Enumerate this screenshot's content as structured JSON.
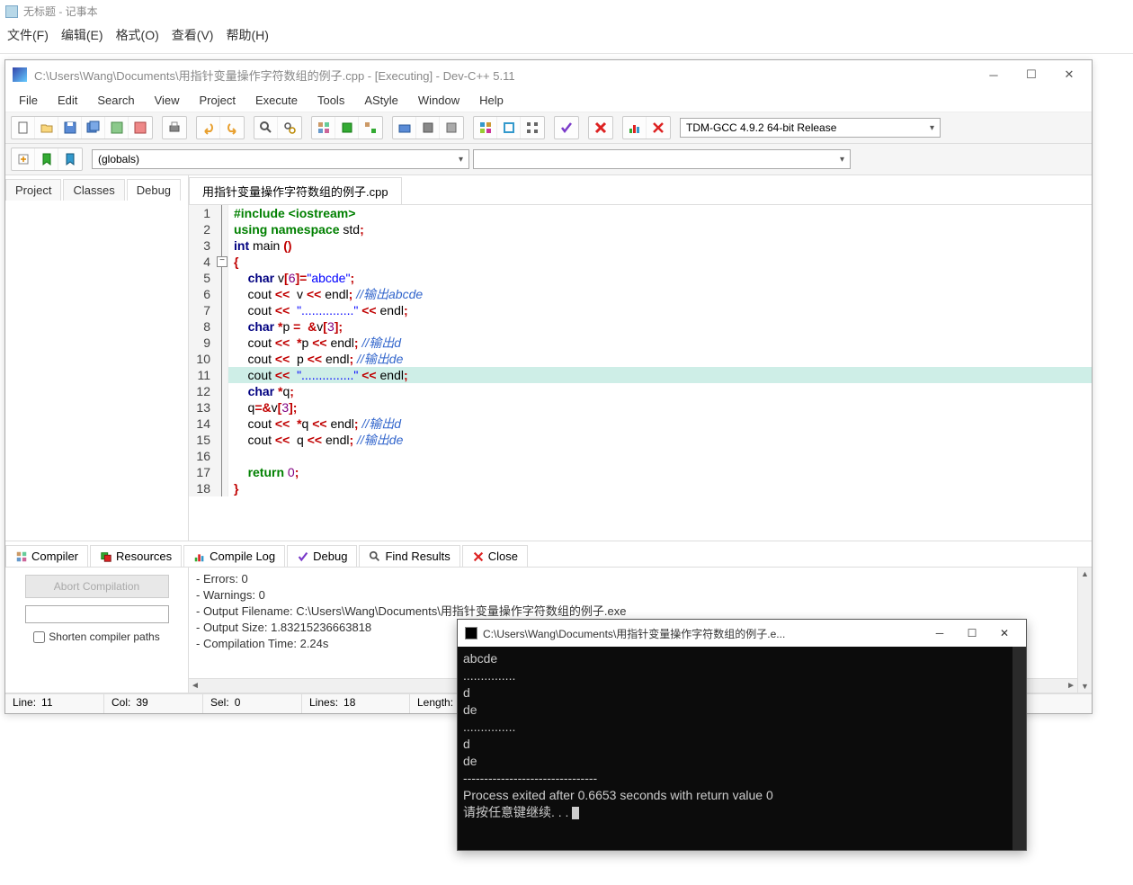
{
  "notepad": {
    "title": "无标题 - 记事本",
    "menu": [
      "文件(F)",
      "编辑(E)",
      "格式(O)",
      "查看(V)",
      "帮助(H)"
    ]
  },
  "devcpp": {
    "title": "C:\\Users\\Wang\\Documents\\用指针变量操作字符数组的例子.cpp - [Executing] - Dev-C++ 5.11",
    "menu": [
      "File",
      "Edit",
      "Search",
      "View",
      "Project",
      "Execute",
      "Tools",
      "AStyle",
      "Window",
      "Help"
    ],
    "compiler": "TDM-GCC 4.9.2 64-bit Release",
    "globals": "(globals)",
    "side_tabs": [
      "Project",
      "Classes",
      "Debug"
    ],
    "active_side_tab": "Debug",
    "file_tab": "用指针变量操作字符数组的例子.cpp",
    "bottom_tabs": [
      "Compiler",
      "Resources",
      "Compile Log",
      "Debug",
      "Find Results",
      "Close"
    ],
    "active_bottom_tab": "Compile Log",
    "abort_label": "Abort Compilation",
    "shorten_label": "Shorten compiler paths"
  },
  "code": {
    "lines": [
      {
        "n": 1,
        "tokens": [
          [
            "pp",
            "#include <iostream>"
          ]
        ]
      },
      {
        "n": 2,
        "tokens": [
          [
            "kw",
            "using namespace "
          ],
          [
            "txt",
            "std"
          ],
          [
            "op",
            ";"
          ]
        ]
      },
      {
        "n": 3,
        "tokens": [
          [
            "kw2",
            "int "
          ],
          [
            "txt",
            "main "
          ],
          [
            "op",
            "()"
          ]
        ]
      },
      {
        "n": 4,
        "fold": true,
        "tokens": [
          [
            "op",
            "{"
          ]
        ]
      },
      {
        "n": 5,
        "tokens": [
          [
            "txt",
            "    "
          ],
          [
            "kw2",
            "char "
          ],
          [
            "txt",
            "v"
          ],
          [
            "op",
            "["
          ],
          [
            "num",
            "6"
          ],
          [
            "op",
            "]="
          ],
          [
            "str",
            "\"abcde\""
          ],
          [
            "op",
            ";"
          ]
        ]
      },
      {
        "n": 6,
        "tokens": [
          [
            "txt",
            "    cout "
          ],
          [
            "op",
            "<<"
          ],
          [
            "txt",
            "  v "
          ],
          [
            "op",
            "<<"
          ],
          [
            "txt",
            " endl"
          ],
          [
            "op",
            ";"
          ],
          [
            "txt",
            " "
          ],
          [
            "cmt",
            "//输出abcde"
          ]
        ]
      },
      {
        "n": 7,
        "tokens": [
          [
            "txt",
            "    cout "
          ],
          [
            "op",
            "<<"
          ],
          [
            "txt",
            "  "
          ],
          [
            "str",
            "\"...............\""
          ],
          [
            "txt",
            " "
          ],
          [
            "op",
            "<<"
          ],
          [
            "txt",
            " endl"
          ],
          [
            "op",
            ";"
          ]
        ]
      },
      {
        "n": 8,
        "tokens": [
          [
            "txt",
            "    "
          ],
          [
            "kw2",
            "char "
          ],
          [
            "op",
            "*"
          ],
          [
            "txt",
            "p "
          ],
          [
            "op",
            "="
          ],
          [
            "txt",
            "  "
          ],
          [
            "op",
            "&"
          ],
          [
            "txt",
            "v"
          ],
          [
            "op",
            "["
          ],
          [
            "num",
            "3"
          ],
          [
            "op",
            "];"
          ]
        ]
      },
      {
        "n": 9,
        "tokens": [
          [
            "txt",
            "    cout "
          ],
          [
            "op",
            "<<"
          ],
          [
            "txt",
            "  "
          ],
          [
            "op",
            "*"
          ],
          [
            "txt",
            "p "
          ],
          [
            "op",
            "<<"
          ],
          [
            "txt",
            " endl"
          ],
          [
            "op",
            ";"
          ],
          [
            "txt",
            " "
          ],
          [
            "cmt",
            "//输出d"
          ]
        ]
      },
      {
        "n": 10,
        "tokens": [
          [
            "txt",
            "    cout "
          ],
          [
            "op",
            "<<"
          ],
          [
            "txt",
            "  p "
          ],
          [
            "op",
            "<<"
          ],
          [
            "txt",
            " endl"
          ],
          [
            "op",
            ";"
          ],
          [
            "txt",
            " "
          ],
          [
            "cmt",
            "//输出de"
          ]
        ]
      },
      {
        "n": 11,
        "hl": true,
        "tokens": [
          [
            "txt",
            "    cout "
          ],
          [
            "op",
            "<<"
          ],
          [
            "txt",
            "  "
          ],
          [
            "str",
            "\"...............\""
          ],
          [
            "txt",
            " "
          ],
          [
            "op",
            "<<"
          ],
          [
            "txt",
            " endl"
          ],
          [
            "op",
            ";"
          ]
        ]
      },
      {
        "n": 12,
        "tokens": [
          [
            "txt",
            "    "
          ],
          [
            "kw2",
            "char "
          ],
          [
            "op",
            "*"
          ],
          [
            "txt",
            "q"
          ],
          [
            "op",
            ";"
          ]
        ]
      },
      {
        "n": 13,
        "tokens": [
          [
            "txt",
            "    q"
          ],
          [
            "op",
            "=&"
          ],
          [
            "txt",
            "v"
          ],
          [
            "op",
            "["
          ],
          [
            "num",
            "3"
          ],
          [
            "op",
            "];"
          ]
        ]
      },
      {
        "n": 14,
        "tokens": [
          [
            "txt",
            "    cout "
          ],
          [
            "op",
            "<<"
          ],
          [
            "txt",
            "  "
          ],
          [
            "op",
            "*"
          ],
          [
            "txt",
            "q "
          ],
          [
            "op",
            "<<"
          ],
          [
            "txt",
            " endl"
          ],
          [
            "op",
            ";"
          ],
          [
            "txt",
            " "
          ],
          [
            "cmt",
            "//输出d"
          ]
        ]
      },
      {
        "n": 15,
        "tokens": [
          [
            "txt",
            "    cout "
          ],
          [
            "op",
            "<<"
          ],
          [
            "txt",
            "  q "
          ],
          [
            "op",
            "<<"
          ],
          [
            "txt",
            " endl"
          ],
          [
            "op",
            ";"
          ],
          [
            "txt",
            " "
          ],
          [
            "cmt",
            "//输出de"
          ]
        ]
      },
      {
        "n": 16,
        "tokens": [
          [
            "txt",
            " "
          ]
        ]
      },
      {
        "n": 17,
        "tokens": [
          [
            "txt",
            "    "
          ],
          [
            "kw",
            "return "
          ],
          [
            "num",
            "0"
          ],
          [
            "op",
            ";"
          ]
        ]
      },
      {
        "n": 18,
        "tokens": [
          [
            "op",
            "}"
          ]
        ]
      }
    ]
  },
  "log": [
    "- Errors: 0",
    "- Warnings: 0",
    "- Output Filename: C:\\Users\\Wang\\Documents\\用指针变量操作字符数组的例子.exe",
    "- Output Size: 1.83215236663818",
    "- Compilation Time: 2.24s"
  ],
  "status": {
    "line_label": "Line:",
    "line": "11",
    "col_label": "Col:",
    "col": "39",
    "sel_label": "Sel:",
    "sel": "0",
    "lines_label": "Lines:",
    "lines": "18",
    "length_label": "Length:"
  },
  "console": {
    "title": "C:\\Users\\Wang\\Documents\\用指针变量操作字符数组的例子.e...",
    "output": [
      "abcde",
      "...............",
      "d",
      "de",
      "...............",
      "d",
      "de",
      "",
      "--------------------------------",
      "Process exited after 0.6653 seconds with return value 0",
      "请按任意键继续. . . "
    ]
  }
}
